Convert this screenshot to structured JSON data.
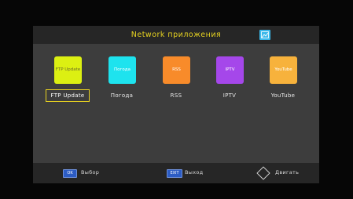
{
  "screen": {
    "title": "Network приложения",
    "header_icon": "picture-icon"
  },
  "apps": [
    {
      "tile_text": "FTP Update",
      "label": "FTP Update",
      "color": "#dcf012",
      "text_color": "#6b6b2a",
      "selected": true
    },
    {
      "tile_text": "Погода",
      "label": "Погода",
      "color": "#1ee3ee",
      "text_color": "#ffffff",
      "selected": false
    },
    {
      "tile_text": "RSS",
      "label": "RSS",
      "color": "#f88b2a",
      "text_color": "#ffffff",
      "selected": false
    },
    {
      "tile_text": "IPTV",
      "label": "IPTV",
      "color": "#a547ea",
      "text_color": "#ffffff",
      "selected": false
    },
    {
      "tile_text": "YouTube",
      "label": "YouTube",
      "color": "#f7b23c",
      "text_color": "#ffffff",
      "selected": false
    }
  ],
  "footer": {
    "ok_key": "OK",
    "ok_label": "Выбор",
    "exit_key": "EXIT",
    "exit_label": "Выход",
    "move_icon": "dpad-arrows-icon",
    "move_label": "Двигать"
  },
  "colors": {
    "accent": "#e9d320",
    "panel": "#3d3d3d",
    "bar": "#262626",
    "key_blue": "#2c5cc4"
  }
}
